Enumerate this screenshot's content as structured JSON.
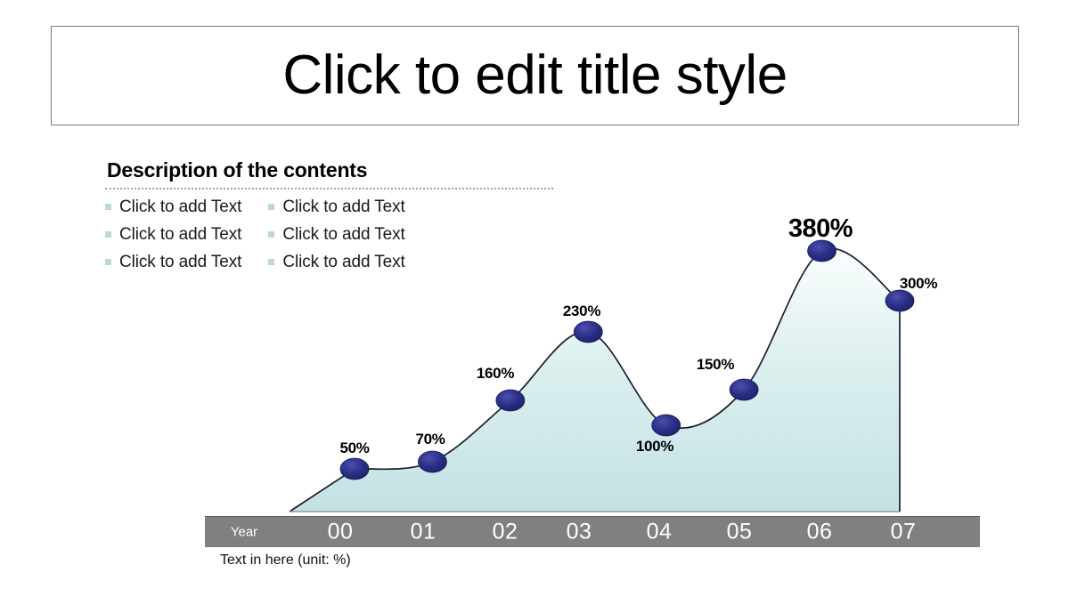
{
  "slide": {
    "title": "Click to edit title style"
  },
  "description": {
    "heading": "Description of the contents",
    "columns": [
      {
        "items": [
          "Click to add Text",
          "Click to add Text",
          "Click to add Text"
        ]
      },
      {
        "items": [
          "Click to add Text",
          "Click to add Text",
          "Click to add Text"
        ]
      }
    ]
  },
  "axis": {
    "row_label": "Year",
    "footnote": "Text in here  (unit: %)"
  },
  "colors": {
    "axis_bar": "#808080",
    "marker": "#2b2f86",
    "area_top": "#fbfdfd",
    "area_bottom": "#c3e2e4",
    "bullet": "#bcd9d9"
  },
  "chart_data": {
    "type": "area",
    "title": "",
    "xlabel": "Year",
    "ylabel": "",
    "unit": "%",
    "categories": [
      "00",
      "01",
      "02",
      "03",
      "04",
      "05",
      "06",
      "07"
    ],
    "values": [
      50,
      70,
      160,
      230,
      100,
      150,
      380,
      300
    ],
    "labels": [
      "50%",
      "70%",
      "160%",
      "230%",
      "100%",
      "150%",
      "380%",
      "300%"
    ],
    "emphasized_point": "06",
    "grid": false,
    "legend": "none",
    "ylim": [
      0,
      420
    ]
  }
}
